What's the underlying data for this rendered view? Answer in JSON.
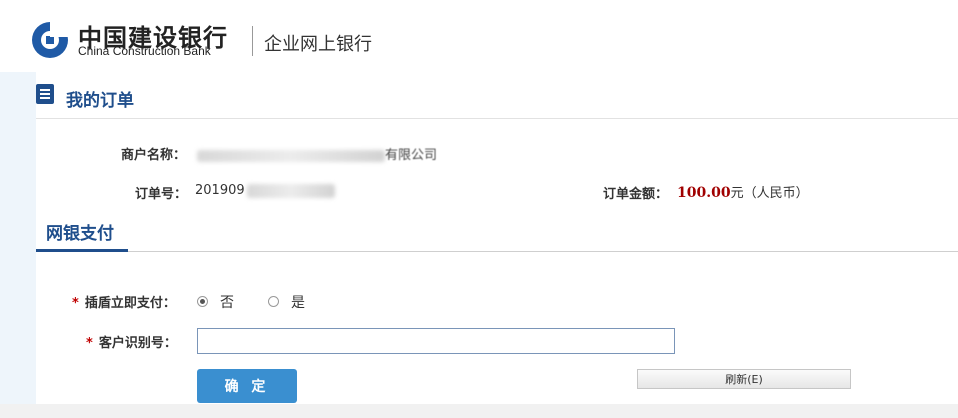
{
  "header": {
    "bank_name_cn": "中国建设银行",
    "bank_name_en": "China Construction Bank",
    "portal_name": "企业网上银行",
    "logo_icon": "ccb-logo-icon",
    "brand_color": "#1f5aa6"
  },
  "order_section": {
    "title": "我的订单",
    "icon": "document-icon",
    "merchant_label": "商户名称：",
    "merchant_value_partial": "有限公司",
    "order_no_label": "订单号：",
    "order_no_value_partial": "201909",
    "amount_label": "订单金额：",
    "amount_value": "100.00",
    "amount_unit": "元（人民币）",
    "amount_color": "#a00000"
  },
  "payment_section": {
    "tab_title": "网银支付",
    "required_mark": "*",
    "ukey_label": "插盾立即支付：",
    "ukey_options": [
      {
        "label": "否",
        "checked": true
      },
      {
        "label": "是",
        "checked": false
      }
    ],
    "customer_id_label": "客户识别号：",
    "customer_id_value": "",
    "confirm_label": "确 定",
    "refresh_label": "刷新(E)",
    "accent_color": "#3a8fd0"
  }
}
